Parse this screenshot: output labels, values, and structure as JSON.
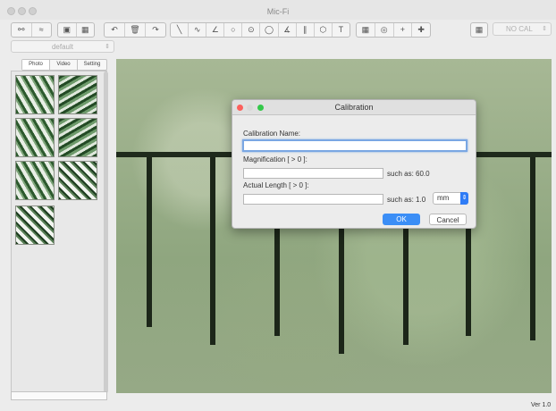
{
  "window": {
    "title": "Mic-Fi"
  },
  "toolbar": {
    "group1": [
      "usb-icon",
      "wifi-icon"
    ],
    "group2": [
      "camera-icon",
      "video-camera-icon"
    ],
    "group3": [
      "undo-icon",
      "delete-icon",
      "redo-icon"
    ],
    "group4": [
      "line-icon",
      "polyline-icon",
      "angle-icon",
      "circle-3pt-icon",
      "circle-center-icon",
      "circle-icon",
      "arc-angle-icon",
      "parallel-icon",
      "polygon-icon",
      "text-icon"
    ],
    "group5": [
      "grid-icon",
      "target-icon",
      "crosshair-icon",
      "crosshair-plus-icon"
    ],
    "calibration_select": {
      "value": "NO CAL"
    }
  },
  "sidebar": {
    "preset": {
      "value": "default"
    },
    "tabs": [
      "Photo",
      "Video",
      "Setting"
    ]
  },
  "gallery": {
    "thumbnail_count": 7
  },
  "dialog": {
    "title": "Calibration",
    "name_label": "Calibration Name:",
    "magnification_label": "Magnification [ > 0 ]:",
    "magnification_hint": "such as: 60.0",
    "length_label": "Actual Length [ > 0 ]:",
    "length_hint": "such as: 1.0",
    "unit_value": "mm",
    "ok_label": "OK",
    "cancel_label": "Cancel"
  },
  "status": {
    "version": "Ver 1.0"
  },
  "colors": {
    "accent": "#3b8ef6",
    "close": "#fc605c",
    "minimize": "#fdbc40",
    "zoom": "#34c84a"
  }
}
